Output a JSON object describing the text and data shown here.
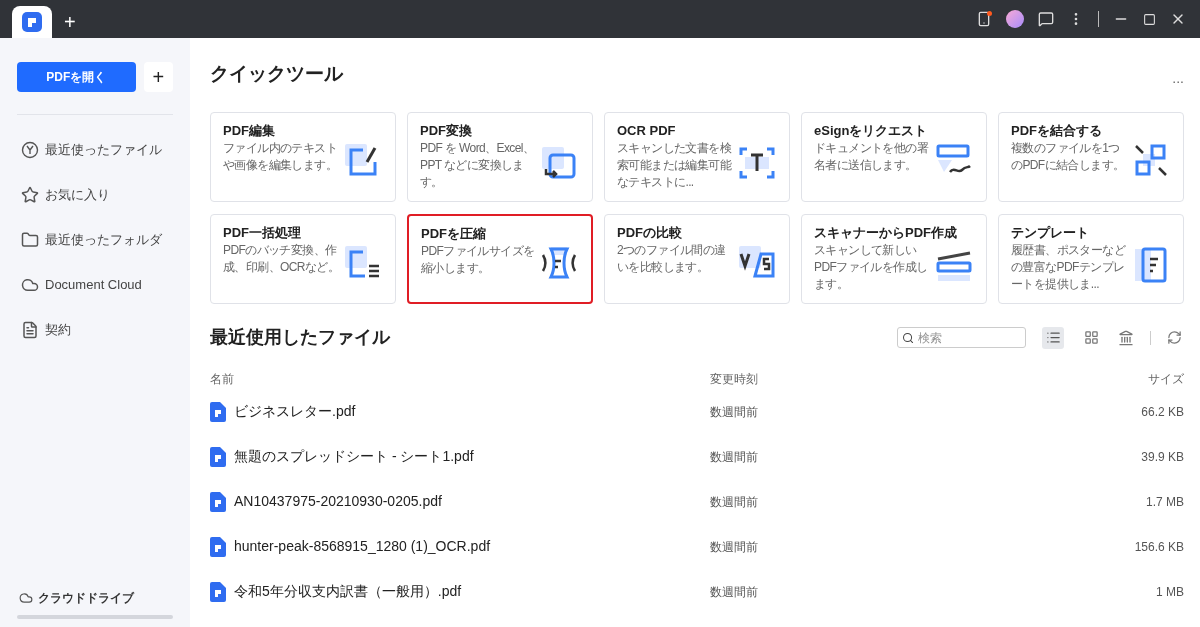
{
  "title_bar": {
    "new_tab": "+"
  },
  "sidebar": {
    "open_button": "PDFを開く",
    "add_button": "+",
    "items": [
      {
        "label": "最近使ったファイル"
      },
      {
        "label": "お気に入り"
      },
      {
        "label": "最近使ったフォルダ"
      },
      {
        "label": "Document Cloud"
      },
      {
        "label": "契約"
      }
    ],
    "footer": "クラウドドライブ"
  },
  "quick_tools": {
    "title": "クイックツール",
    "more": "...",
    "cards": [
      {
        "title": "PDF編集",
        "description": "ファイル内のテキストや画像を編集します。",
        "highlighted": false
      },
      {
        "title": "PDF変換",
        "description": "PDF を Word、Excel、PPT などに変換します。",
        "highlighted": false
      },
      {
        "title": "OCR PDF",
        "description": "スキャンした文書を検索可能または編集可能なテキストに...",
        "highlighted": false
      },
      {
        "title": "eSignをリクエスト",
        "description": "ドキュメントを他の署名者に送信します。",
        "highlighted": false
      },
      {
        "title": "PDFを結合する",
        "description": "複数のファイルを1つのPDFに結合します。",
        "highlighted": false
      },
      {
        "title": "PDF一括処理",
        "description": "PDFのバッチ変換、作成、印刷、OCRなど。",
        "highlighted": false
      },
      {
        "title": "PDFを圧縮",
        "description": "PDFファイルサイズを縮小します。",
        "highlighted": true
      },
      {
        "title": "PDFの比較",
        "description": "2つのファイル間の違いを比較します。",
        "highlighted": false
      },
      {
        "title": "スキャナーからPDF作成",
        "description": "スキャンして新しいPDFファイルを作成します。",
        "highlighted": false
      },
      {
        "title": "テンプレート",
        "description": "履歴書、ポスターなどの豊富なPDFテンプレートを提供しま...",
        "highlighted": false
      }
    ]
  },
  "recent_files": {
    "title": "最近使用したファイル",
    "search": {
      "placeholder": "検索"
    },
    "view_buttons": [
      {
        "selected": true
      },
      {
        "selected": false
      }
    ],
    "columns": [
      "名前",
      "変更時刻",
      "サイズ"
    ],
    "rows": [
      {
        "name": "ビジネスレター.pdf",
        "modified": "数週間前",
        "size": "66.2 KB"
      },
      {
        "name": "無題のスプレッドシート - シート1.pdf",
        "modified": "数週間前",
        "size": "39.9 KB"
      },
      {
        "name": "AN10437975-20210930-0205.pdf",
        "modified": "数週間前",
        "size": "1.7 MB"
      },
      {
        "name": "hunter-peak-8568915_1280 (1)_OCR.pdf",
        "modified": "数週間前",
        "size": "156.6 KB"
      },
      {
        "name": "令和5年分収支内訳書（一般用）.pdf",
        "modified": "数週間前",
        "size": "1 MB"
      }
    ]
  }
}
